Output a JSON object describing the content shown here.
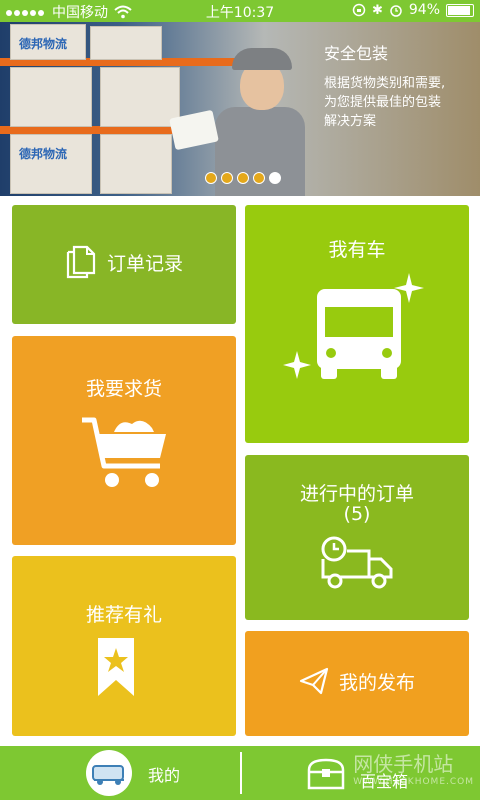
{
  "status_bar": {
    "carrier": "中国移动",
    "time": "上午10:37",
    "battery": "94%",
    "battery_level": 0.94
  },
  "banner": {
    "box_logo": "德邦物流",
    "title": "安全包装",
    "description_lines": [
      "根据货物类别和需要,",
      "为您提供最佳的包装",
      "解决方案"
    ],
    "pages": 5,
    "active_page": 5
  },
  "tiles": {
    "order_records": "订单记录",
    "my_car": "我有车",
    "request_goods": "我要求货",
    "in_progress": "进行中的订单",
    "in_progress_count": "(5)",
    "recommend_gift": "推荐有礼",
    "my_publish": "我的发布"
  },
  "tabbar": {
    "mine": "我的",
    "treasure_box": "百宝箱"
  },
  "watermark": {
    "text": "网侠手机站",
    "url": "WWW.HACKHOME.COM"
  },
  "colors": {
    "bar_green": "#7ec832",
    "tile_green_dark": "#88b626",
    "tile_green_light": "#98cb0e",
    "tile_orange": "#f0a024",
    "tile_yellow": "#ebc11d"
  }
}
